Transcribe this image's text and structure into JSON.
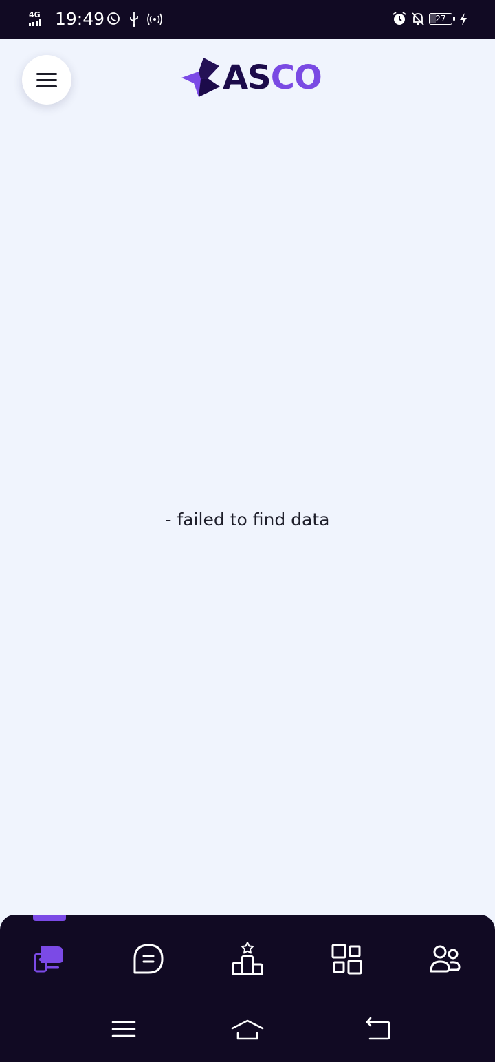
{
  "status_bar": {
    "network": "4G",
    "time": "19:49",
    "battery_level": "27",
    "left_icons": [
      "whatsapp-icon",
      "usb-icon",
      "hotspot-icon"
    ],
    "right_icons": [
      "alarm-icon",
      "bell-off-icon",
      "battery-icon",
      "charging-icon"
    ]
  },
  "header": {
    "logo": {
      "part1": "AS",
      "part2": "CO"
    }
  },
  "main": {
    "empty_message": "- failed to find data"
  },
  "bottom_nav": {
    "active_index": 0,
    "items": [
      {
        "icon": "cards-icon"
      },
      {
        "icon": "chat-icon"
      },
      {
        "icon": "leaderboard-icon"
      },
      {
        "icon": "grid-icon"
      },
      {
        "icon": "users-icon"
      }
    ]
  },
  "system_nav": {
    "buttons": [
      "menu-icon",
      "home-icon",
      "back-icon"
    ]
  },
  "colors": {
    "status_bg": "#110a23",
    "page_bg": "#f0f4fd",
    "accent": "#7b4ae6",
    "logo_dark": "#1c0b4a",
    "nav_icon": "#ffffff"
  }
}
